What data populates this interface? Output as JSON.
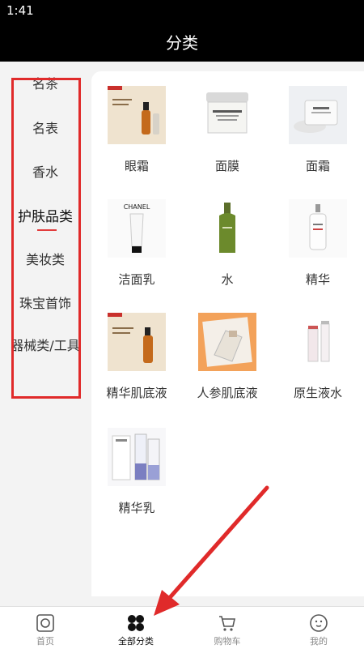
{
  "status": {
    "time": "1:41"
  },
  "header": {
    "title": "分类"
  },
  "sidebar": {
    "items": [
      {
        "label": "名茶"
      },
      {
        "label": "名表"
      },
      {
        "label": "香水"
      },
      {
        "label": "护肤品类"
      },
      {
        "label": "美妆类"
      },
      {
        "label": "珠宝首饰"
      },
      {
        "label": "器械类/工具"
      }
    ],
    "active_index": 3
  },
  "products": [
    {
      "label": "眼霜"
    },
    {
      "label": "面膜"
    },
    {
      "label": "面霜"
    },
    {
      "label": "洁面乳"
    },
    {
      "label": "水"
    },
    {
      "label": "精华"
    },
    {
      "label": "精华肌底液"
    },
    {
      "label": "人参肌底液"
    },
    {
      "label": "原生液水"
    },
    {
      "label": "精华乳"
    }
  ],
  "tabbar": {
    "items": [
      {
        "label": "首页",
        "icon": "home-icon"
      },
      {
        "label": "全部分类",
        "icon": "category-icon"
      },
      {
        "label": "购物车",
        "icon": "cart-icon"
      },
      {
        "label": "我的",
        "icon": "profile-icon"
      }
    ],
    "active_index": 1
  },
  "annotation": {
    "color": "#e02a2a"
  },
  "colors": {
    "accent": "#e23c3c",
    "header_bg": "#000000"
  }
}
